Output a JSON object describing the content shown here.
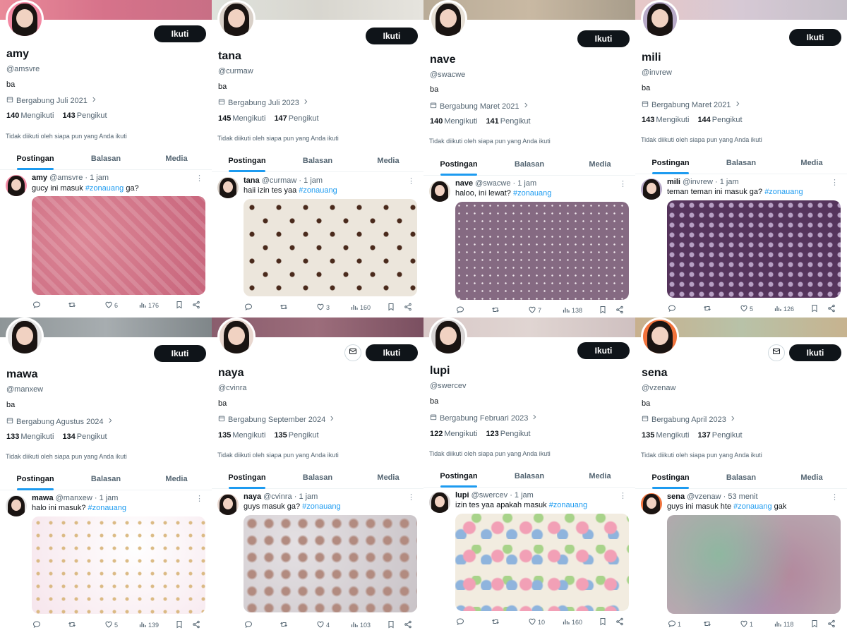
{
  "common": {
    "follow_label": "Ikuti",
    "bio": "ba",
    "following_label": "Mengikuti",
    "followers_label": "Pengikut",
    "not_followed_text": "Tidak diikuti oleh siapa pun yang Anda ikuti",
    "tabs": [
      "Postingan",
      "Balasan",
      "Media"
    ],
    "hashtag": "#zonauang",
    "more_glyph": "⋮"
  },
  "colors": {
    "accent": "#1d9bf0",
    "button": "#0f1419",
    "muted": "#536471"
  },
  "profiles": [
    {
      "name": "amy",
      "handle": "@amsvre",
      "joined": "Bergabung Juli 2021",
      "following": "140",
      "followers": "143",
      "time": "1 jam",
      "post_before": "gucy ini masuk ",
      "post_after": " ga?",
      "replies": "",
      "likes": "6",
      "views": "176",
      "has_message_button": false
    },
    {
      "name": "tana",
      "handle": "@curmaw",
      "joined": "Bergabung Juli 2023",
      "following": "145",
      "followers": "147",
      "time": "1 jam",
      "post_before": "haii izin tes yaa ",
      "post_after": "",
      "replies": "",
      "likes": "3",
      "views": "160",
      "has_message_button": false
    },
    {
      "name": "nave",
      "handle": "@swacwe",
      "joined": "Bergabung Maret 2021",
      "following": "140",
      "followers": "141",
      "time": "1 jam",
      "post_before": "haloo, ini lewat? ",
      "post_after": "",
      "replies": "",
      "likes": "7",
      "views": "138",
      "has_message_button": false
    },
    {
      "name": "mili",
      "handle": "@invrew",
      "joined": "Bergabung Maret 2021",
      "following": "143",
      "followers": "144",
      "time": "1 jam",
      "post_before": "teman teman ini masuk ga? ",
      "post_after": "",
      "replies": "",
      "likes": "5",
      "views": "126",
      "has_message_button": false
    },
    {
      "name": "mawa",
      "handle": "@manxew",
      "joined": "Bergabung Agustus 2024",
      "following": "133",
      "followers": "134",
      "time": "1 jam",
      "post_before": "halo ini masuk? ",
      "post_after": "",
      "replies": "",
      "likes": "5",
      "views": "139",
      "has_message_button": false
    },
    {
      "name": "naya",
      "handle": "@cvinra",
      "joined": "Bergabung September 2024",
      "following": "135",
      "followers": "135",
      "time": "1 jam",
      "post_before": "guys masuk ga? ",
      "post_after": "",
      "replies": "",
      "likes": "4",
      "views": "103",
      "has_message_button": true
    },
    {
      "name": "lupi",
      "handle": "@swercev",
      "joined": "Bergabung Februari 2023",
      "following": "122",
      "followers": "123",
      "time": "1 jam",
      "post_before": "izin tes yaa apakah masuk ",
      "post_after": "",
      "replies": "",
      "likes": "10",
      "views": "160",
      "has_message_button": false
    },
    {
      "name": "sena",
      "handle": "@vzenaw",
      "joined": "Bergabung April 2023",
      "following": "135",
      "followers": "137",
      "time": "53 menit",
      "post_before": "guys ini masuk hte ",
      "post_after": " gak",
      "replies": "1",
      "likes": "1",
      "views": "118",
      "has_message_button": true
    }
  ]
}
